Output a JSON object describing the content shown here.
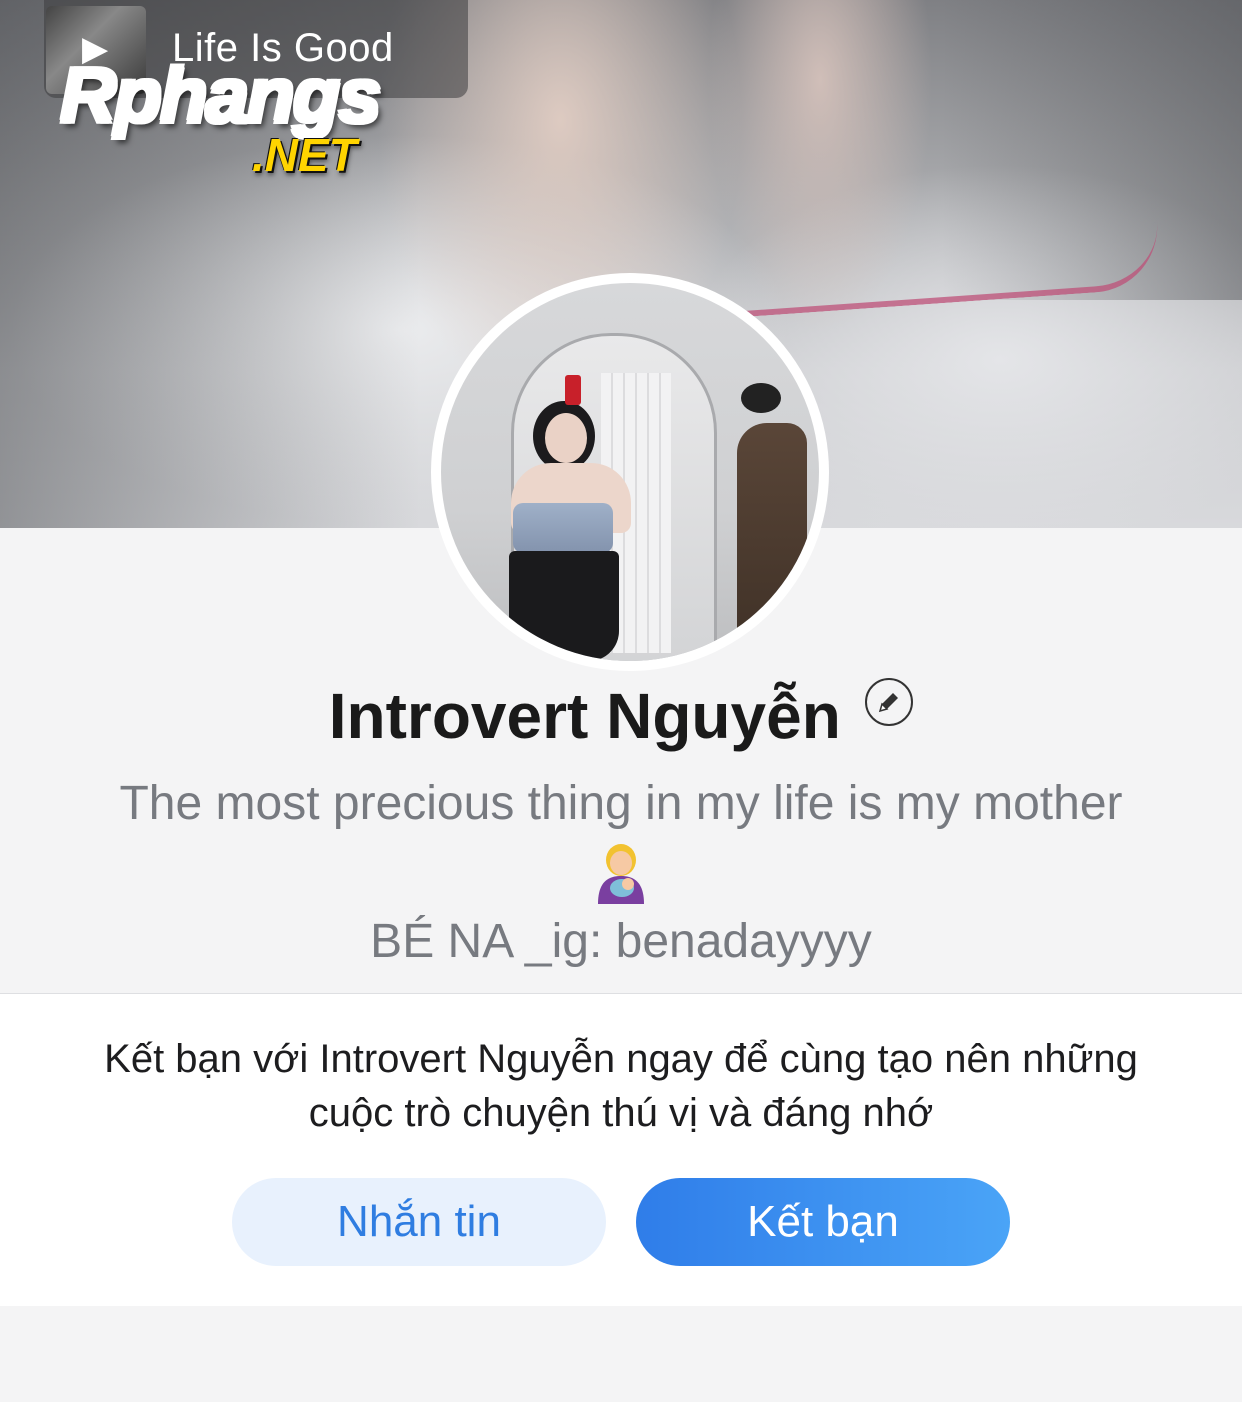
{
  "cover": {
    "watermark": {
      "play_glyph": "▶",
      "caption": "Life Is Good",
      "brand": "Rphangs",
      "domain": ".NET"
    }
  },
  "profile": {
    "name": "Introvert Nguyễn",
    "edit_icon": "pencil-icon",
    "bio_line": "The most precious thing in my life is my mother",
    "bio_emoji": "woman-feeding-baby-emoji",
    "subtitle": "BÉ NA _ig: benadayyyy"
  },
  "friend_card": {
    "message": "Kết bạn với Introvert Nguyễn ngay để cùng tạo nên những cuộc trò chuyện thú vị và đáng nhớ",
    "message_button": "Nhắn tin",
    "add_friend_button": "Kết bạn"
  },
  "colors": {
    "page_background": "#f4f4f5",
    "primary": "#2f7de9",
    "secondary_button_bg": "#e8f1fd",
    "muted_text": "#777a80"
  }
}
